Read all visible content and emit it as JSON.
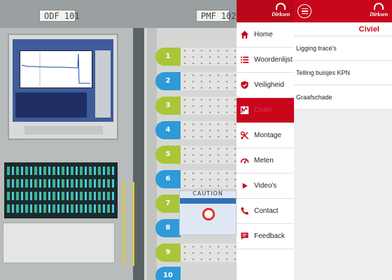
{
  "photo": {
    "odf_label": "ODF   101",
    "pmf_label": "PMF   102",
    "sticker_text": "CAUTION",
    "tray_numbers": [
      "1",
      "2",
      "3",
      "4",
      "5",
      "6",
      "7",
      "8",
      "9",
      "10"
    ]
  },
  "brand": {
    "name": "Dirksen",
    "accent_color": "#c8071d",
    "sidebar_header_color": "#b9071a"
  },
  "sidebar": {
    "items": [
      {
        "label": "Home",
        "icon": "home-icon",
        "active": false
      },
      {
        "label": "Woordenlijst",
        "icon": "list-icon",
        "active": false
      },
      {
        "label": "Veiligheid",
        "icon": "shield-icon",
        "active": false
      },
      {
        "label": "Civiel",
        "icon": "civiel-icon",
        "active": true
      },
      {
        "label": "Montage",
        "icon": "tools-icon",
        "active": false
      },
      {
        "label": "Meten",
        "icon": "gauge-icon",
        "active": false
      },
      {
        "label": "Video's",
        "icon": "play-icon",
        "active": false
      },
      {
        "label": "Contact",
        "icon": "phone-icon",
        "active": false
      },
      {
        "label": "Feedback",
        "icon": "feedback-icon",
        "active": false
      }
    ]
  },
  "main": {
    "menu_icon": "hamburger-icon",
    "section_title": "Civiel",
    "items": [
      {
        "label": "Ligging trace's"
      },
      {
        "label": "Telling buisjes KPN"
      },
      {
        "label": "Graafschade"
      }
    ]
  }
}
